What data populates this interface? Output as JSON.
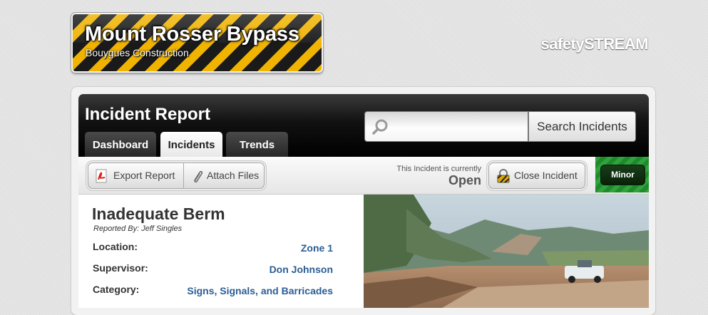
{
  "header": {
    "project_title": "Mount Rosser Bypass",
    "company": "Bouygues Construction",
    "brand": "safetySTREAM"
  },
  "page": {
    "title": "Incident Report"
  },
  "tabs": [
    {
      "label": "Dashboard",
      "active": false
    },
    {
      "label": "Incidents",
      "active": true
    },
    {
      "label": "Trends",
      "active": false
    }
  ],
  "search": {
    "placeholder": "",
    "button_label": "Search Incidents",
    "icon": "search-icon"
  },
  "toolbar": {
    "export_label": "Export Report",
    "attach_label": "Attach Files",
    "status_prefix": "This Incident is currently",
    "status_value": "Open",
    "close_label": "Close Incident",
    "severity": "Minor"
  },
  "incident": {
    "title": "Inadequate Berm",
    "reported_by": "Reported By: Jeff Singles",
    "fields": [
      {
        "label": "Location:",
        "value": "Zone 1"
      },
      {
        "label": "Supervisor:",
        "value": "Don Johnson"
      },
      {
        "label": "Category:",
        "value": "Signs, Signals, and Barricades"
      }
    ]
  },
  "colors": {
    "accent_link": "#2b5d94",
    "severity_green": "#2fa33c",
    "hazard_yellow": "#f0b300"
  }
}
